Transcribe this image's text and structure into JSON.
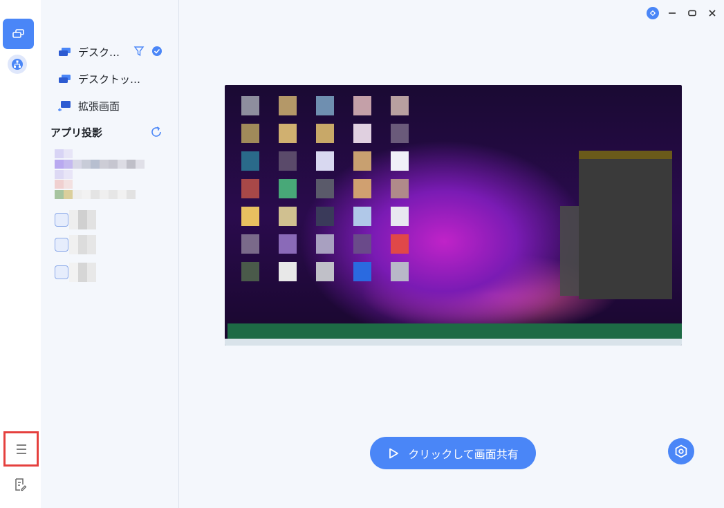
{
  "sidebar": {
    "items": [
      {
        "icon": "screen-share-icon",
        "active": true
      },
      {
        "icon": "network-icon",
        "active": false
      },
      {
        "icon": "menu-icon",
        "active": false
      },
      {
        "icon": "notes-icon",
        "active": false
      }
    ]
  },
  "sources": {
    "items": [
      {
        "label": "デスク…",
        "icon": "monitor-icon"
      },
      {
        "label": "デスクトッ…",
        "icon": "monitor-icon"
      },
      {
        "label": "拡張画面",
        "icon": "extend-screen-icon"
      }
    ],
    "filter_icon": "filter-icon",
    "check_icon": "check-circle-icon"
  },
  "apps": {
    "title": "アプリ投影",
    "refresh_icon": "refresh-icon"
  },
  "window_controls": [
    "pin-icon",
    "minimize-icon",
    "maximize-icon",
    "close-icon"
  ],
  "actions": {
    "share_label": "クリックして画面共有",
    "settings_icon": "settings-icon"
  },
  "colors": {
    "accent": "#4a86f7",
    "highlight_border": "#e5403e"
  }
}
